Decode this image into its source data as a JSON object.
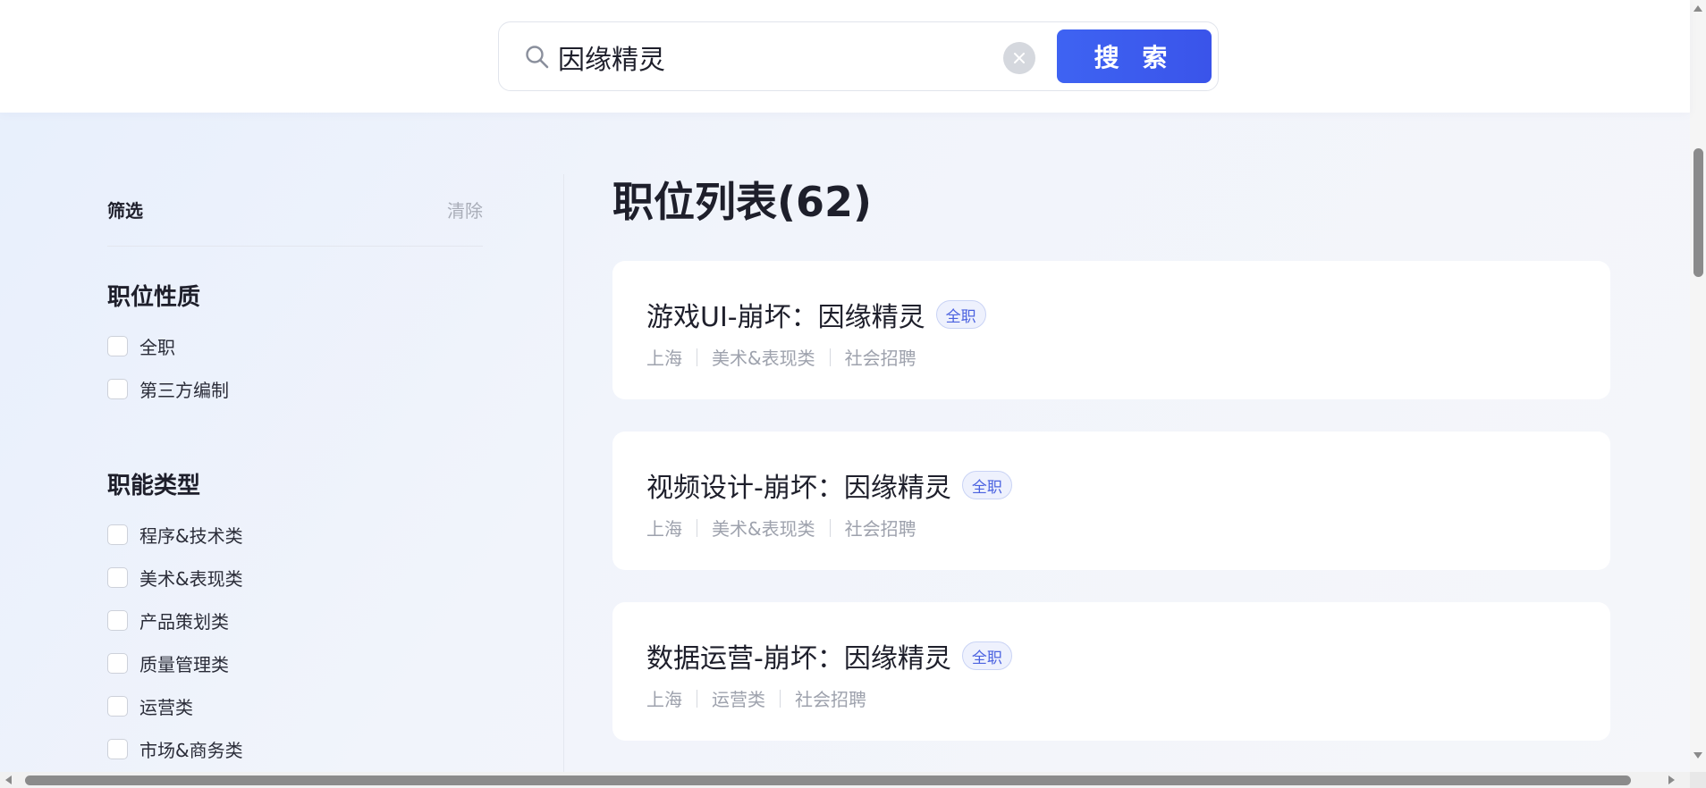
{
  "search": {
    "query": "因缘精灵",
    "button_label": "搜 索"
  },
  "filters": {
    "title": "筛选",
    "clear_label": "清除",
    "groups": [
      {
        "title": "职位性质",
        "options": [
          "全职",
          "第三方编制"
        ]
      },
      {
        "title": "职能类型",
        "options": [
          "程序&技术类",
          "美术&表现类",
          "产品策划类",
          "质量管理类",
          "运营类",
          "市场&商务类"
        ]
      }
    ]
  },
  "jobs": {
    "title": "职位列表(62)",
    "items": [
      {
        "title": "游戏UI-崩坏：因缘精灵",
        "badge": "全职",
        "city": "上海",
        "category": "美术&表现类",
        "recruit_type": "社会招聘"
      },
      {
        "title": "视频设计-崩坏：因缘精灵",
        "badge": "全职",
        "city": "上海",
        "category": "美术&表现类",
        "recruit_type": "社会招聘"
      },
      {
        "title": "数据运营-崩坏：因缘精灵",
        "badge": "全职",
        "city": "上海",
        "category": "运营类",
        "recruit_type": "社会招聘"
      }
    ]
  },
  "colors": {
    "accent": "#3e63f2",
    "badge_text": "#4b62e0",
    "muted_text": "#9ea2ad"
  }
}
